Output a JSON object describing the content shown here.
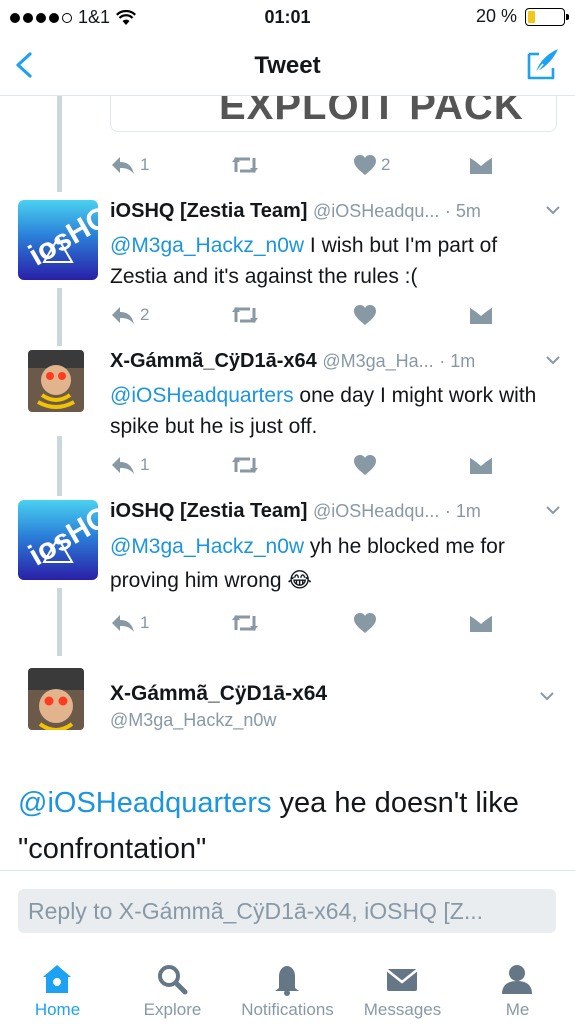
{
  "status_bar": {
    "carrier": "1&1",
    "time": "01:01",
    "battery": "20 %",
    "battery_level": 0.2
  },
  "nav": {
    "title": "Tweet"
  },
  "card_fragment": {
    "text": "EXPLOIT PACK"
  },
  "tweets": [
    {
      "name": "iOSHQ [Zestia Team]",
      "handle": "@iOSHeadqu...",
      "time": "· 5m",
      "mention": "@M3ga_Hackz_n0w",
      "text": " I wish but I'm part of Zestia and it's against the rules :(",
      "avatar_text": "iosHQ"
    },
    {
      "name": "X-Gámmã_CÿD1ā-x64",
      "handle": "@M3ga_Ha...",
      "time": "· 1m",
      "mention": "@iOSHeadquarters",
      "text": " one day I might work with spike but he is just off."
    },
    {
      "name": "iOSHQ [Zestia Team]",
      "handle": "@iOSHeadqu...",
      "time": "· 1m",
      "mention": "@M3ga_Hackz_n0w",
      "text": " yh he blocked me for proving him wrong 😂",
      "avatar_text": "iosHQ"
    }
  ],
  "actions": [
    {
      "reply": "1",
      "retweet": "",
      "like": "2"
    },
    {
      "reply": "2",
      "retweet": "",
      "like": ""
    },
    {
      "reply": "1",
      "retweet": "",
      "like": ""
    },
    {
      "reply": "1",
      "retweet": "",
      "like": ""
    }
  ],
  "focused": {
    "name": "X-Gámmã_CÿD1ā-x64",
    "handle": "@M3ga_Hackz_n0w",
    "mention": "@iOSHeadquarters",
    "text": " yea he doesn't like \"confrontation\""
  },
  "reply": {
    "placeholder": "Reply to X-Gámmã_CÿD1ā-x64, iOSHQ [Z..."
  },
  "tabs": [
    {
      "label": "Home",
      "icon": "home-icon",
      "active": true
    },
    {
      "label": "Explore",
      "icon": "search-icon"
    },
    {
      "label": "Notifications",
      "icon": "bell-icon"
    },
    {
      "label": "Messages",
      "icon": "envelope-icon"
    },
    {
      "label": "Me",
      "icon": "person-icon"
    }
  ],
  "colors": {
    "accent": "#1da1f2",
    "link": "#1b95e0",
    "muted": "#8899a6",
    "battery": "#f5c518"
  }
}
